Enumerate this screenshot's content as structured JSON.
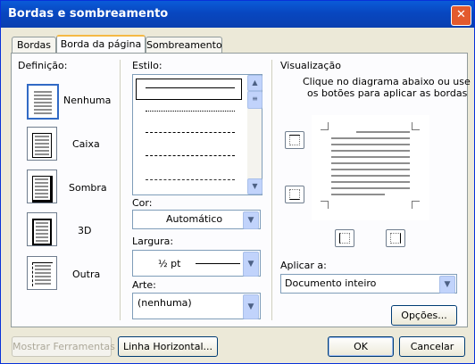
{
  "window": {
    "title": "Bordas e sombreamento"
  },
  "tabs": [
    {
      "label": "Bordas"
    },
    {
      "label": "Borda da página"
    },
    {
      "label": "Sombreamento"
    }
  ],
  "definition": {
    "label": "Definição:",
    "options": [
      {
        "label": "Nenhuma"
      },
      {
        "label": "Caixa"
      },
      {
        "label": "Sombra"
      },
      {
        "label": "3D"
      },
      {
        "label": "Outra"
      }
    ]
  },
  "style": {
    "label": "Estilo:"
  },
  "color": {
    "label": "Cor:",
    "value": "Automático"
  },
  "width": {
    "label": "Largura:",
    "value": "½ pt"
  },
  "art": {
    "label": "Arte:",
    "value": "(nenhuma)"
  },
  "preview": {
    "label": "Visualização",
    "hint_line1": "Clique no diagrama abaixo ou use",
    "hint_line2": "os botões para aplicar as bordas"
  },
  "apply": {
    "label": "Aplicar a:",
    "value": "Documento inteiro"
  },
  "buttons": {
    "options": "Opções...",
    "show_tools": "Mostrar Ferramentas",
    "horizontal_line": "Linha Horizontal...",
    "ok": "OK",
    "cancel": "Cancelar"
  }
}
